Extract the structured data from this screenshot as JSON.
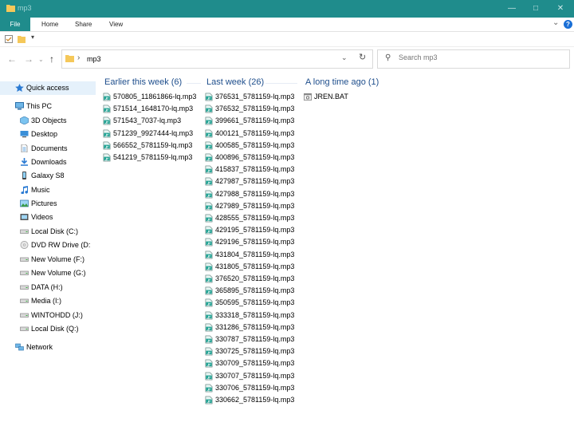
{
  "window": {
    "title": "mp3"
  },
  "ribbon": {
    "tabs": [
      "File",
      "Home",
      "Share",
      "View"
    ]
  },
  "address": {
    "path": "mp3",
    "search_placeholder": "Search mp3"
  },
  "sidebar": {
    "items": [
      {
        "label": "Quick access",
        "icon": "star-icon",
        "indent": 0
      },
      {
        "label": "This PC",
        "icon": "pc-icon",
        "indent": 0
      },
      {
        "label": "3D Objects",
        "icon": "cube-icon",
        "indent": 1
      },
      {
        "label": "Desktop",
        "icon": "desktop-icon",
        "indent": 1
      },
      {
        "label": "Documents",
        "icon": "documents-icon",
        "indent": 1
      },
      {
        "label": "Downloads",
        "icon": "download-icon",
        "indent": 1
      },
      {
        "label": "Galaxy S8",
        "icon": "phone-icon",
        "indent": 1
      },
      {
        "label": "Music",
        "icon": "music-icon",
        "indent": 1
      },
      {
        "label": "Pictures",
        "icon": "pictures-icon",
        "indent": 1
      },
      {
        "label": "Videos",
        "icon": "videos-icon",
        "indent": 1
      },
      {
        "label": "Local Disk (C:)",
        "icon": "drive-icon",
        "indent": 1
      },
      {
        "label": "DVD RW Drive (D:",
        "icon": "dvd-icon",
        "indent": 1
      },
      {
        "label": "New Volume (F:)",
        "icon": "drive-icon",
        "indent": 1
      },
      {
        "label": "New Volume (G:)",
        "icon": "drive-icon",
        "indent": 1
      },
      {
        "label": "DATA (H:)",
        "icon": "drive-icon",
        "indent": 1
      },
      {
        "label": "Media (I:)",
        "icon": "drive-icon",
        "indent": 1
      },
      {
        "label": "WINTOHDD (J:)",
        "icon": "drive-icon",
        "indent": 1
      },
      {
        "label": "Local Disk (Q:)",
        "icon": "drive-icon",
        "indent": 1
      },
      {
        "label": "Network",
        "icon": "network-icon",
        "indent": 0
      }
    ]
  },
  "groups": [
    {
      "title": "Earlier this week (6)",
      "files": [
        "570805_11861866-lq.mp3",
        "571514_1648170-lq.mp3",
        "571543_7037-lq.mp3",
        "571239_9927444-lq.mp3",
        "566552_5781159-lq.mp3",
        "541219_5781159-lq.mp3"
      ]
    },
    {
      "title": "Last week (26)",
      "files": [
        "376531_5781159-lq.mp3",
        "376532_5781159-lq.mp3",
        "399661_5781159-lq.mp3",
        "400121_5781159-lq.mp3",
        "400585_5781159-lq.mp3",
        "400896_5781159-lq.mp3",
        "415837_5781159-lq.mp3",
        "427987_5781159-lq.mp3",
        "427988_5781159-lq.mp3",
        "427989_5781159-lq.mp3",
        "428555_5781159-lq.mp3",
        "429195_5781159-lq.mp3",
        "429196_5781159-lq.mp3",
        "431804_5781159-lq.mp3",
        "431805_5781159-lq.mp3",
        "376520_5781159-lq.mp3",
        "365895_5781159-lq.mp3",
        "350595_5781159-lq.mp3",
        "333318_5781159-lq.mp3",
        "331286_5781159-lq.mp3",
        "330787_5781159-lq.mp3",
        "330725_5781159-lq.mp3",
        "330709_5781159-lq.mp3",
        "330707_5781159-lq.mp3",
        "330706_5781159-lq.mp3",
        "330662_5781159-lq.mp3"
      ]
    },
    {
      "title": "A long time ago (1)",
      "files": [
        "JREN.BAT"
      ]
    }
  ],
  "colors": {
    "accent": "#1f8c8c",
    "group_header": "#1e4e8c",
    "selection": "#e5f1fb"
  }
}
